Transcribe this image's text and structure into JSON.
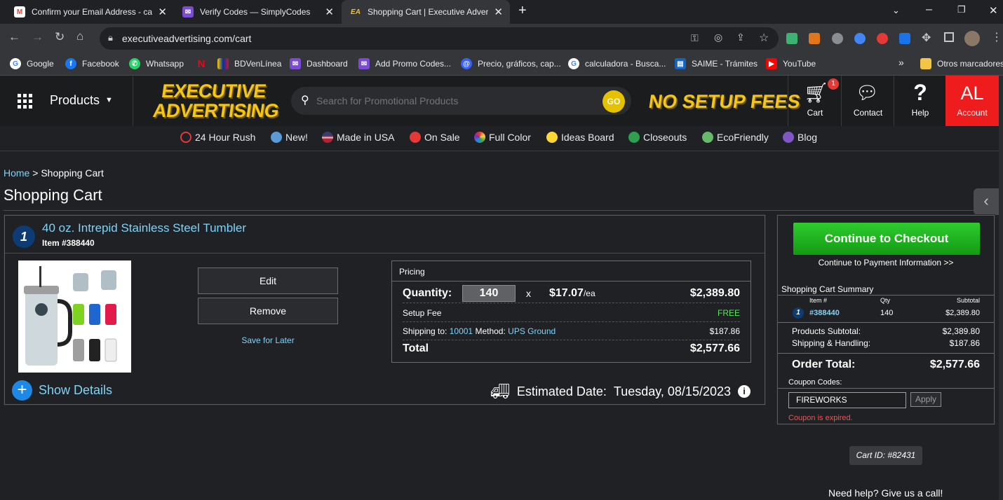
{
  "browser": {
    "tabs": [
      {
        "title": "Confirm your Email Address - cap",
        "favicon": "gmail-icon"
      },
      {
        "title": "Verify Codes — SimplyCodes",
        "favicon": "simplycodes-icon"
      },
      {
        "title": "Shopping Cart | Executive Advert",
        "favicon": "ea-icon"
      }
    ],
    "new_tab": "+",
    "url": "executiveadvertising.com/cart",
    "bookmarks": [
      {
        "label": "Google"
      },
      {
        "label": "Facebook"
      },
      {
        "label": "Whatsapp"
      },
      {
        "label": ""
      },
      {
        "label": "BDVenLínea"
      },
      {
        "label": "Dashboard"
      },
      {
        "label": "Add Promo Codes..."
      },
      {
        "label": "Precio, gráficos, cap..."
      },
      {
        "label": "calculadora - Busca..."
      },
      {
        "label": "SAIME - Trámites"
      },
      {
        "label": "YouTube"
      }
    ],
    "more_bookmarks": "»",
    "other_bookmarks": "Otros marcadores"
  },
  "header": {
    "products_label": "Products",
    "logo_line1": "EXECUTIVE",
    "logo_line2": "ADVERTISING",
    "search_placeholder": "Search for Promotional Products",
    "go_label": "GO",
    "promo": "NO SETUP FEES",
    "cart_label": "Cart",
    "cart_count": "1",
    "contact_label": "Contact",
    "help_label": "Help",
    "account_initials": "AL",
    "account_label": "Account"
  },
  "categories": [
    "24 Hour Rush",
    "New!",
    "Made in USA",
    "On Sale",
    "Full Color",
    "Ideas Board",
    "Closeouts",
    "EcoFriendly",
    "Blog"
  ],
  "breadcrumb": {
    "home": "Home",
    "sep": " > ",
    "current": "Shopping Cart"
  },
  "page_title": "Shopping Cart",
  "item": {
    "number": "1",
    "name": "40 oz. Intrepid Stainless Steel Tumbler",
    "item_no": "Item #388440",
    "edit": "Edit",
    "remove": "Remove",
    "save_later": "Save for Later",
    "show_details": "Show Details",
    "est_label": "Estimated Date:",
    "est_date": "Tuesday, 08/15/2023"
  },
  "pricing": {
    "title": "Pricing",
    "qty_label": "Quantity:",
    "qty": "140",
    "times": "x",
    "unit_price": "$17.07",
    "unit_suffix": "/ea",
    "line_total": "$2,389.80",
    "setup_label": "Setup Fee",
    "setup_value": "FREE",
    "ship_to_label": "Shipping to:",
    "ship_zip": "10001",
    "method_label": "Method:",
    "method": "UPS Ground",
    "ship_value": "$187.86",
    "total_label": "Total",
    "total_value": "$2,577.66"
  },
  "summary": {
    "checkout": "Continue to Checkout",
    "checkout_sub": "Continue to Payment Information >>",
    "title": "Shopping Cart Summary",
    "cols": [
      "Item #",
      "Qty",
      "Subtotal"
    ],
    "row": {
      "num": "1",
      "item": "#388440",
      "qty": "140",
      "subtotal": "$2,389.80"
    },
    "products_subtotal_label": "Products Subtotal:",
    "products_subtotal": "$2,389.80",
    "shipping_label": "Shipping & Handling:",
    "shipping": "$187.86",
    "order_total_label": "Order Total:",
    "order_total": "$2,577.66",
    "coupon_label": "Coupon Codes:",
    "coupon_value": "FIREWORKS",
    "apply": "Apply",
    "coupon_error": "Coupon is expired."
  },
  "cart_id": "Cart ID: #82431",
  "need_help": "Need help? Give us a call!",
  "colors": {
    "accent": "#7fd3f7",
    "checkout_green": "#1fae1f",
    "account_red": "#ee1c1c",
    "logo_yellow": "#f5c518",
    "error": "#ff4d4d",
    "free_green": "#5ee35e"
  }
}
